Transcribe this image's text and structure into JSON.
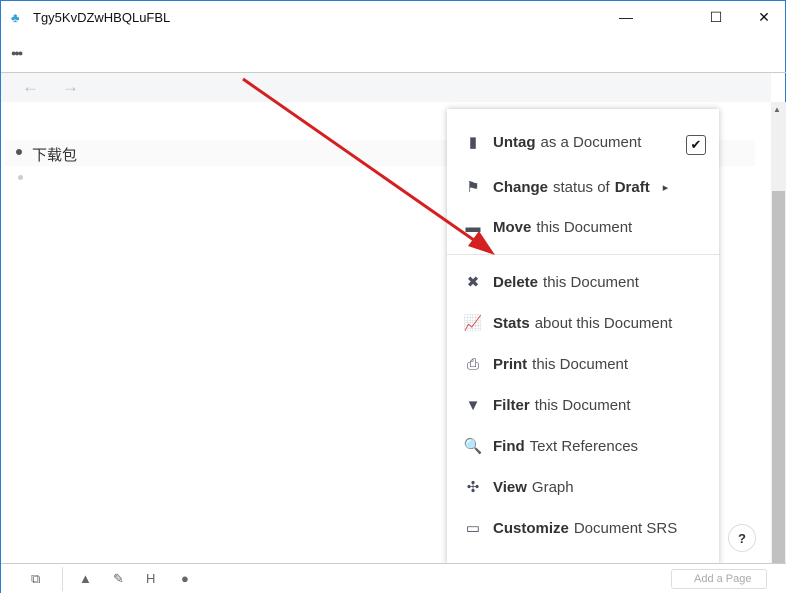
{
  "window": {
    "title": "Tgy5KvDZwHBQLuFBL",
    "minimize": "—",
    "maximize": "☐",
    "close": "✕"
  },
  "toolbar": {
    "more": "●●●",
    "back": "←",
    "forward": "→"
  },
  "content": {
    "blocks": [
      "下载包",
      ""
    ]
  },
  "menu": {
    "items": [
      {
        "icon": "file-icon",
        "glyph": "▮",
        "bold": "Untag",
        "rest": "as a Document",
        "checked": true
      },
      {
        "icon": "checkered-flag-icon",
        "glyph": "⚑",
        "bold": "Change",
        "rest": "status of",
        "bold2": "Draft",
        "submenu": "▸"
      },
      {
        "icon": "folder-icon",
        "glyph": "▬",
        "bold": "Move",
        "rest": "this Document"
      },
      {
        "icon": "times-icon",
        "glyph": "✖",
        "bold": "Delete",
        "rest": "this Document"
      },
      {
        "icon": "line-chart-icon",
        "glyph": "📈",
        "bold": "Stats",
        "rest": "about this Document"
      },
      {
        "icon": "print-icon",
        "glyph": "⎙",
        "bold": "Print",
        "rest": "this Document"
      },
      {
        "icon": "filter-icon",
        "glyph": "▼",
        "bold": "Filter",
        "rest": "this Document"
      },
      {
        "icon": "search-icon",
        "glyph": "🔍",
        "bold": "Find",
        "rest": "Text References"
      },
      {
        "icon": "graph-icon",
        "glyph": "✣",
        "bold": "View",
        "rest": "Graph"
      },
      {
        "icon": "inbox-icon",
        "glyph": "▭",
        "bold": "Customize",
        "rest": "Document SRS"
      }
    ],
    "checkmark": "✔"
  },
  "footer": {
    "icons": [
      "documents-icon",
      "warning-icon",
      "brush-icon",
      "heading-icon",
      "circle-icon"
    ],
    "glyphs": [
      "⧉",
      "▲",
      "✎",
      "H",
      "●"
    ],
    "search_placeholder": "Add a Page",
    "help": "?"
  }
}
